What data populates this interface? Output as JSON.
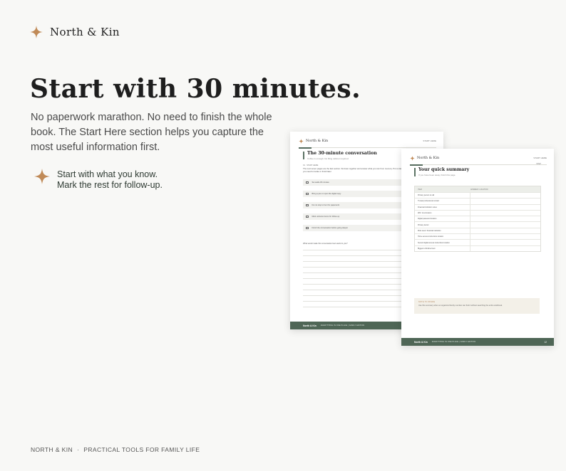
{
  "brand": {
    "name": "North & Kin"
  },
  "hero": {
    "headline": "Start with 30 minutes.",
    "lead": "No paperwork marathon. No need to finish the whole book. The Start Here section helps you capture the most useful information first.",
    "tip_line1": "Start with what you know.",
    "tip_line2": "Mark the rest for follow-up."
  },
  "footer": {
    "brand": "NORTH & KIN",
    "separator": "·",
    "tagline": "PRACTICAL TOOLS FOR FAMILY LIFE"
  },
  "colors": {
    "accent_gold": "#c08a57",
    "forest_green": "#4f6656",
    "background": "#f8f8f6"
  },
  "page_left": {
    "brand": "North & Kin",
    "section": "START HERE",
    "title": "The 30-minute conversation",
    "subtitle": "Coffee is enough. No filing cabinet required.",
    "kicker": "01 · START HERE",
    "intro": "The next seven pages are the fast section. Sit down together and answer what you can from memory. Put a star beside anything you need to locate or finish later.",
    "checklist": [
      "Set aside 30 minutes",
      "Bring a pen or open the digital copy",
      "Do not stop to hunt for paperwork",
      "Mark unknown items for follow-up",
      "Finish the conversation before going deeper"
    ],
    "question": "What would make this conversation feel useful to you?",
    "footer_brand": "North & Kin",
    "footer_text": "EVERYTHING IN ONE PLACE  |  FAMILY EDITION"
  },
  "page_right": {
    "brand": "North & Kin",
    "section": "START HERE",
    "step": "STEP",
    "title": "Your quick summary",
    "subtitle": "If you have been away, finish this page.",
    "table_headers": [
      "ITEM",
      "ANSWER / LOCATION"
    ],
    "table_rows": [
      "Primary person to call",
      "Trusted professional contact",
      "Financial institution notes",
      "Will / trust location",
      "Digital password location",
      "Primary doctor",
      "Most used / financial institution",
      "Home access instructions location",
      "Second digital access instructions location",
      "Biggest unfinished item"
    ],
    "note_title": "NOTE TO SHARE",
    "note_body": "Use this summary when an organized family member can find it without searching the entire workbook.",
    "footer_brand": "North & Kin",
    "footer_text": "EVERYTHING IN ONE PLACE  |  FAMILY EDITION",
    "page_number": "12"
  }
}
